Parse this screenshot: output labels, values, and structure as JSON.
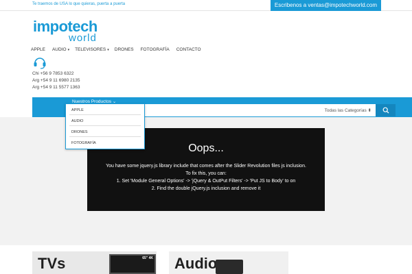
{
  "topbar": {
    "tagline": "Te traemos de USA lo que quieras, puerta a puerta",
    "contact": "Escribenos a ventas@impotechworld.com"
  },
  "logo": {
    "main": "impotech",
    "sub": "world"
  },
  "nav": {
    "items": [
      {
        "label": "APPLE",
        "caret": ""
      },
      {
        "label": "AUDIO",
        "caret": "▾"
      },
      {
        "label": "TELEVISORES",
        "caret": "▾"
      },
      {
        "label": "DRONES",
        "caret": ""
      },
      {
        "label": "FOTOGRAFÍA",
        "caret": ""
      },
      {
        "label": "CONTACTO",
        "caret": ""
      }
    ]
  },
  "phones": [
    "Chi +56 9 7853 6322",
    "Arg +54 9 11 6980 2135",
    "Arg +54 9 11 5577 1363"
  ],
  "products_menu": {
    "label": "Nuestros Productos",
    "caret": "⌄",
    "items": [
      "APPLE",
      "AUDIO",
      "DRONES",
      "FOTOGRAFÍA"
    ]
  },
  "search": {
    "category": "Todas las Categorías",
    "category_caret": "⬍"
  },
  "error_box": {
    "title": "Oops...",
    "lines": [
      "You have some jquery.js library include that comes after the Slider Revolution files js inclusion.",
      "To fix this, you can:",
      "1. Set 'Module General Options' -> 'jQuery & OutPut Filters' -> 'Put JS to Body' to on",
      "2. Find the double jQuery.js inclusion and remove it"
    ]
  },
  "banners": {
    "tv": {
      "title": "TVs",
      "badge": "65\" 4K"
    },
    "audio": {
      "title": "Audio"
    }
  },
  "colors": {
    "accent": "#1a9ad6",
    "dark": "#111111"
  },
  "icons": {
    "support": "headset-icon",
    "search": "search-icon"
  }
}
